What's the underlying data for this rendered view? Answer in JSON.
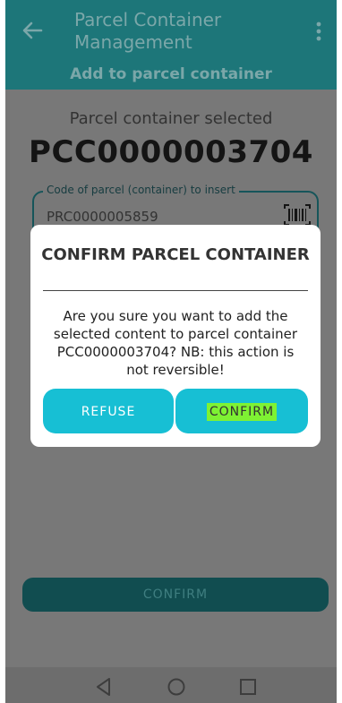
{
  "app": {
    "title": "Parcel Container Management",
    "subtitle": "Add to parcel container"
  },
  "main": {
    "selected_label": "Parcel container selected",
    "selected_code": "PCC0000003704",
    "field_label": "Code of parcel (container) to insert",
    "field_value": "PRC0000005859",
    "confirm_button": "CONFIRM"
  },
  "dialog": {
    "title": "CONFIRM PARCEL CONTAINER",
    "message": "Are you sure you want to add the selected content to parcel container PCC0000003704? NB: this action is not reversible!",
    "refuse_label": "REFUSE",
    "confirm_label": "CONFIRM"
  },
  "colors": {
    "appbar": "#1d7679",
    "dialog_button": "#17bfd4",
    "highlight": "#7ef233"
  },
  "icons": [
    "back-arrow-icon",
    "more-vert-icon",
    "barcode-icon",
    "nav-back-icon",
    "nav-home-icon",
    "nav-recents-icon"
  ]
}
